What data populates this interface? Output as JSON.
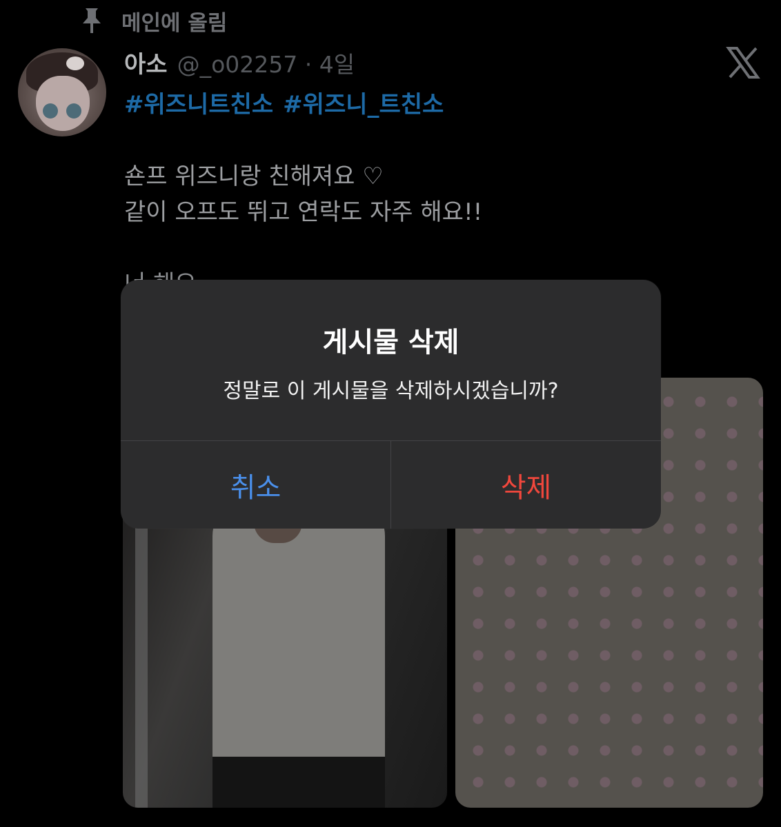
{
  "pinned": {
    "label": "메인에 올림"
  },
  "tweet": {
    "author_name": "아소",
    "handle_time": "@_o02257 · 4일",
    "hashtags": [
      "#위즈니트친소",
      "#위즈니_트친소"
    ],
    "lines": [
      "숀프 위즈니랑 친해져요 ♡",
      "같이 오프도 뛰고 연락도 자주 해요!!"
    ],
    "partial_line": "너                                                                        해요"
  },
  "dialog": {
    "title": "게시물 삭제",
    "message": "정말로 이 게시물을 삭제하시겠습니까?",
    "cancel_label": "취소",
    "delete_label": "삭제"
  },
  "colors": {
    "background": "#000000",
    "dialog_bg": "#2c2c2d",
    "hashtag": "#1d6aa6",
    "cancel": "#4a8fea",
    "delete": "#f0473c"
  },
  "icons": [
    "pin-icon",
    "x-logo-icon"
  ]
}
